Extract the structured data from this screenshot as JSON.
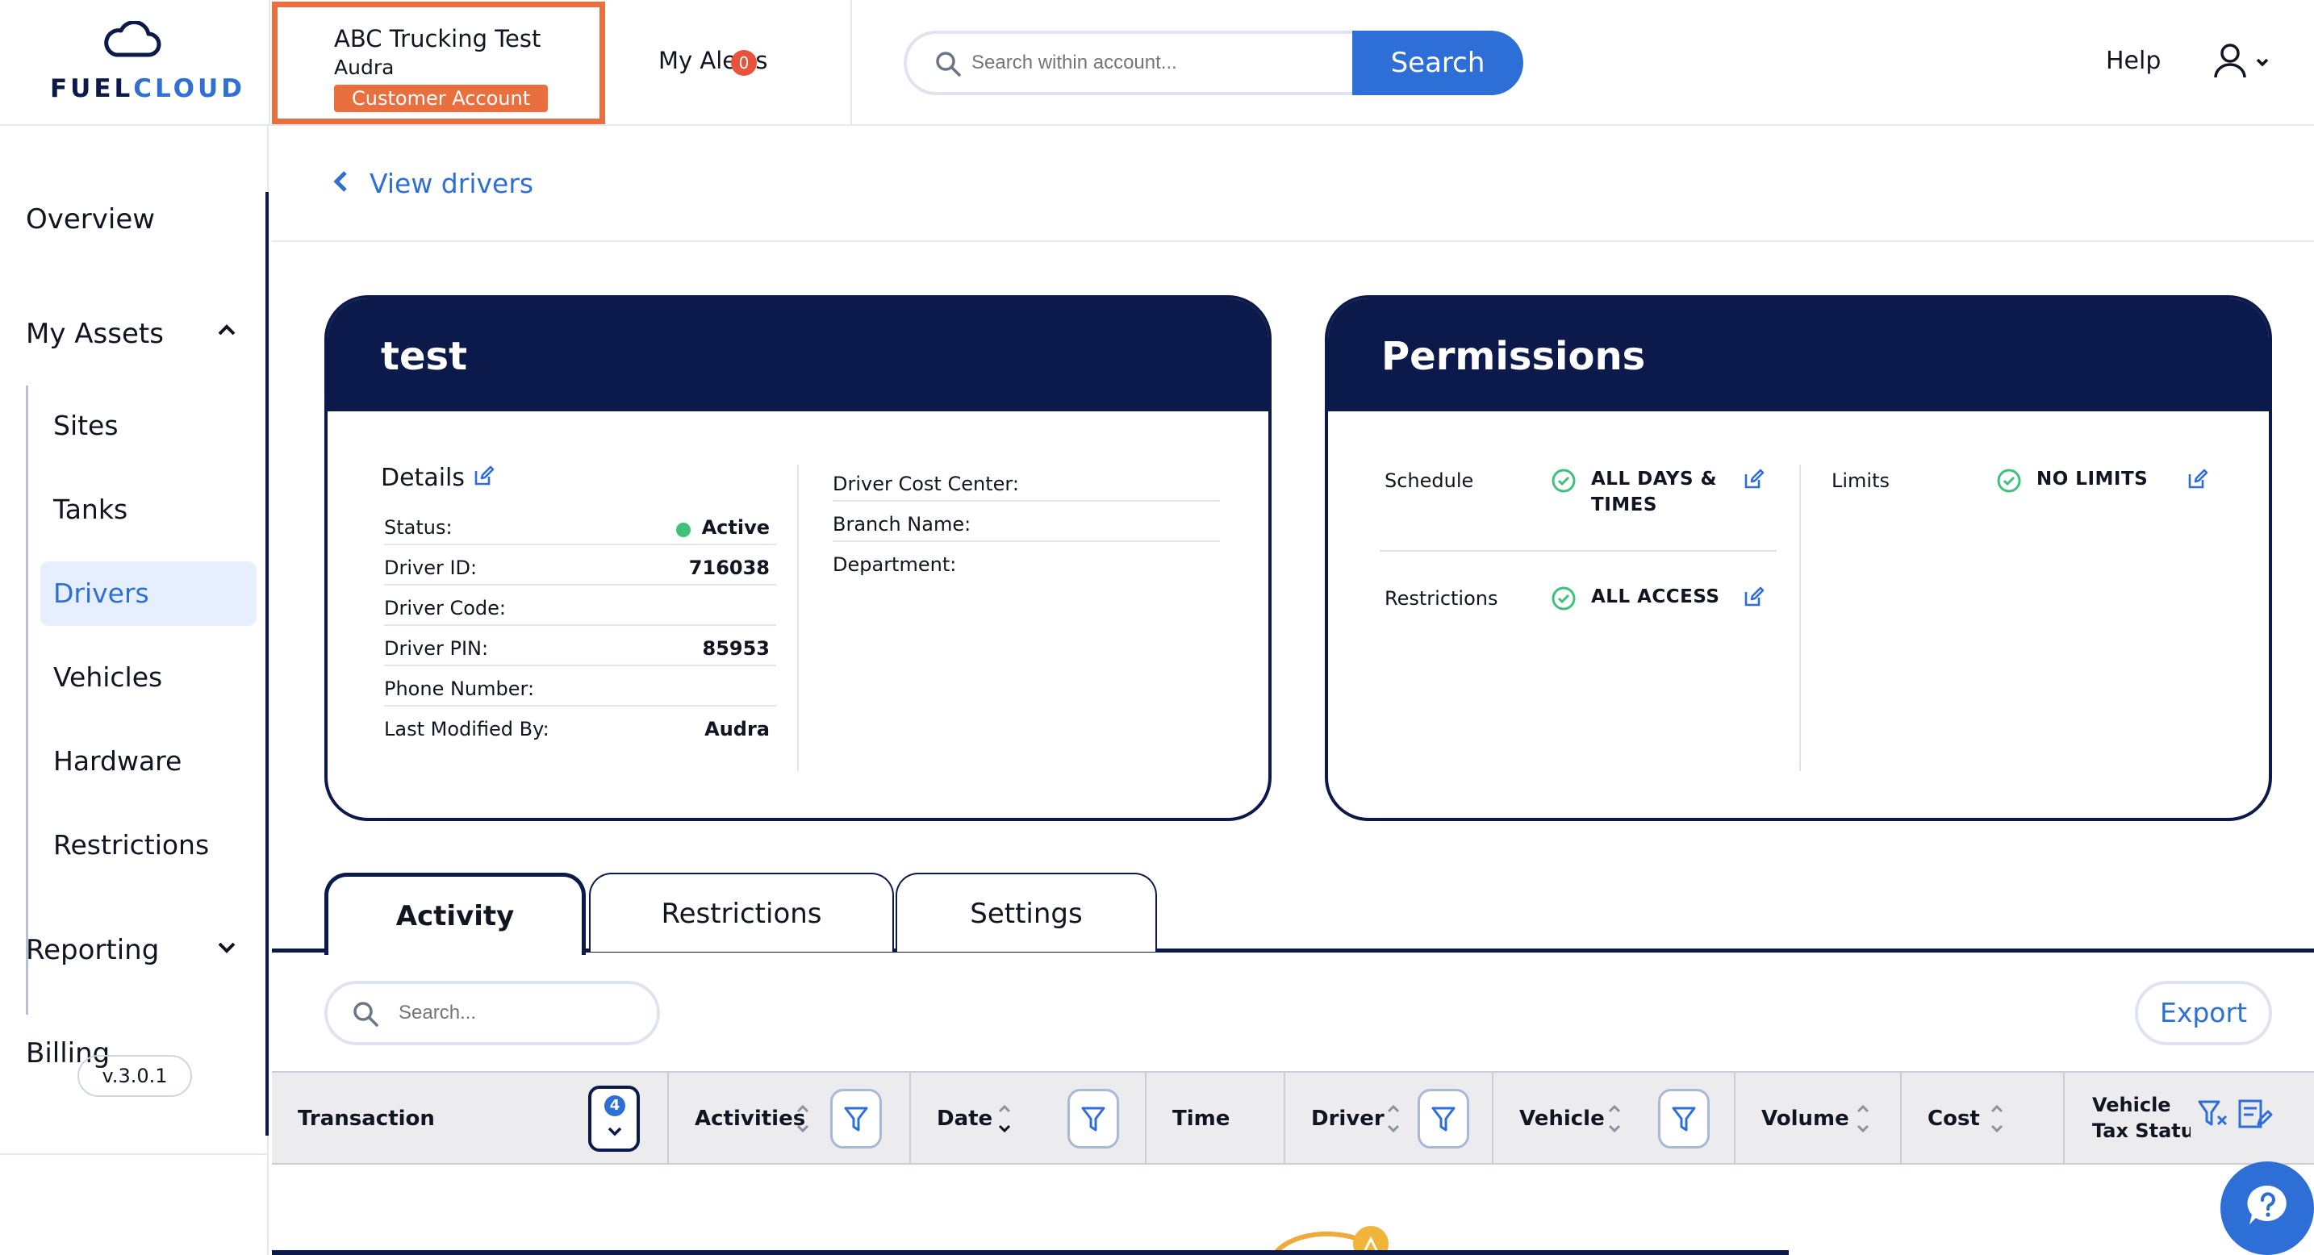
{
  "header": {
    "brand": {
      "part1": "FUEL",
      "part2": "CLOUD"
    },
    "account": {
      "name": "ABC Trucking Test",
      "user": "Audra",
      "badge": "Customer Account"
    },
    "alerts": {
      "label": "My Alerts",
      "count": "0"
    },
    "search": {
      "placeholder": "Search within account...",
      "button": "Search"
    },
    "help": "Help"
  },
  "sidebar": {
    "overview": "Overview",
    "my_assets": "My Assets",
    "items": [
      "Sites",
      "Tanks",
      "Drivers",
      "Vehicles",
      "Hardware",
      "Restrictions"
    ],
    "reporting": "Reporting",
    "billing": "Billing",
    "version": "v.3.0.1"
  },
  "breadcrumb": "View drivers",
  "driver": {
    "name": "test",
    "details_title": "Details",
    "rows": [
      {
        "k": "Status:",
        "v": "Active"
      },
      {
        "k": "Driver ID:",
        "v": "716038"
      },
      {
        "k": "Driver Code:",
        "v": ""
      },
      {
        "k": "Driver PIN:",
        "v": "85953"
      },
      {
        "k": "Phone Number:",
        "v": ""
      },
      {
        "k": "Last Modified By:",
        "v": "Audra"
      }
    ],
    "rows2": [
      "Driver Cost Center:",
      "Branch Name:",
      "Department:"
    ]
  },
  "permissions": {
    "title": "Permissions",
    "schedule": {
      "label": "Schedule",
      "value1": "ALL DAYS &",
      "value2": "TIMES"
    },
    "restrictions": {
      "label": "Restrictions",
      "value": "ALL ACCESS"
    },
    "limits": {
      "label": "Limits",
      "value": "NO LIMITS"
    }
  },
  "tabs": [
    "Activity",
    "Restrictions",
    "Settings"
  ],
  "table": {
    "search_placeholder": "Search...",
    "export": "Export",
    "row_count": "4",
    "columns": [
      "Transaction",
      "Activities",
      "Date",
      "Time",
      "Driver",
      "Vehicle",
      "Volume",
      "Cost",
      "Vehicle",
      "Tax Status"
    ]
  },
  "colors": {
    "navy": "#0c1a4b",
    "blue": "#2d6fd6",
    "orange": "#e9703e",
    "active_green": "#3ec27a"
  }
}
